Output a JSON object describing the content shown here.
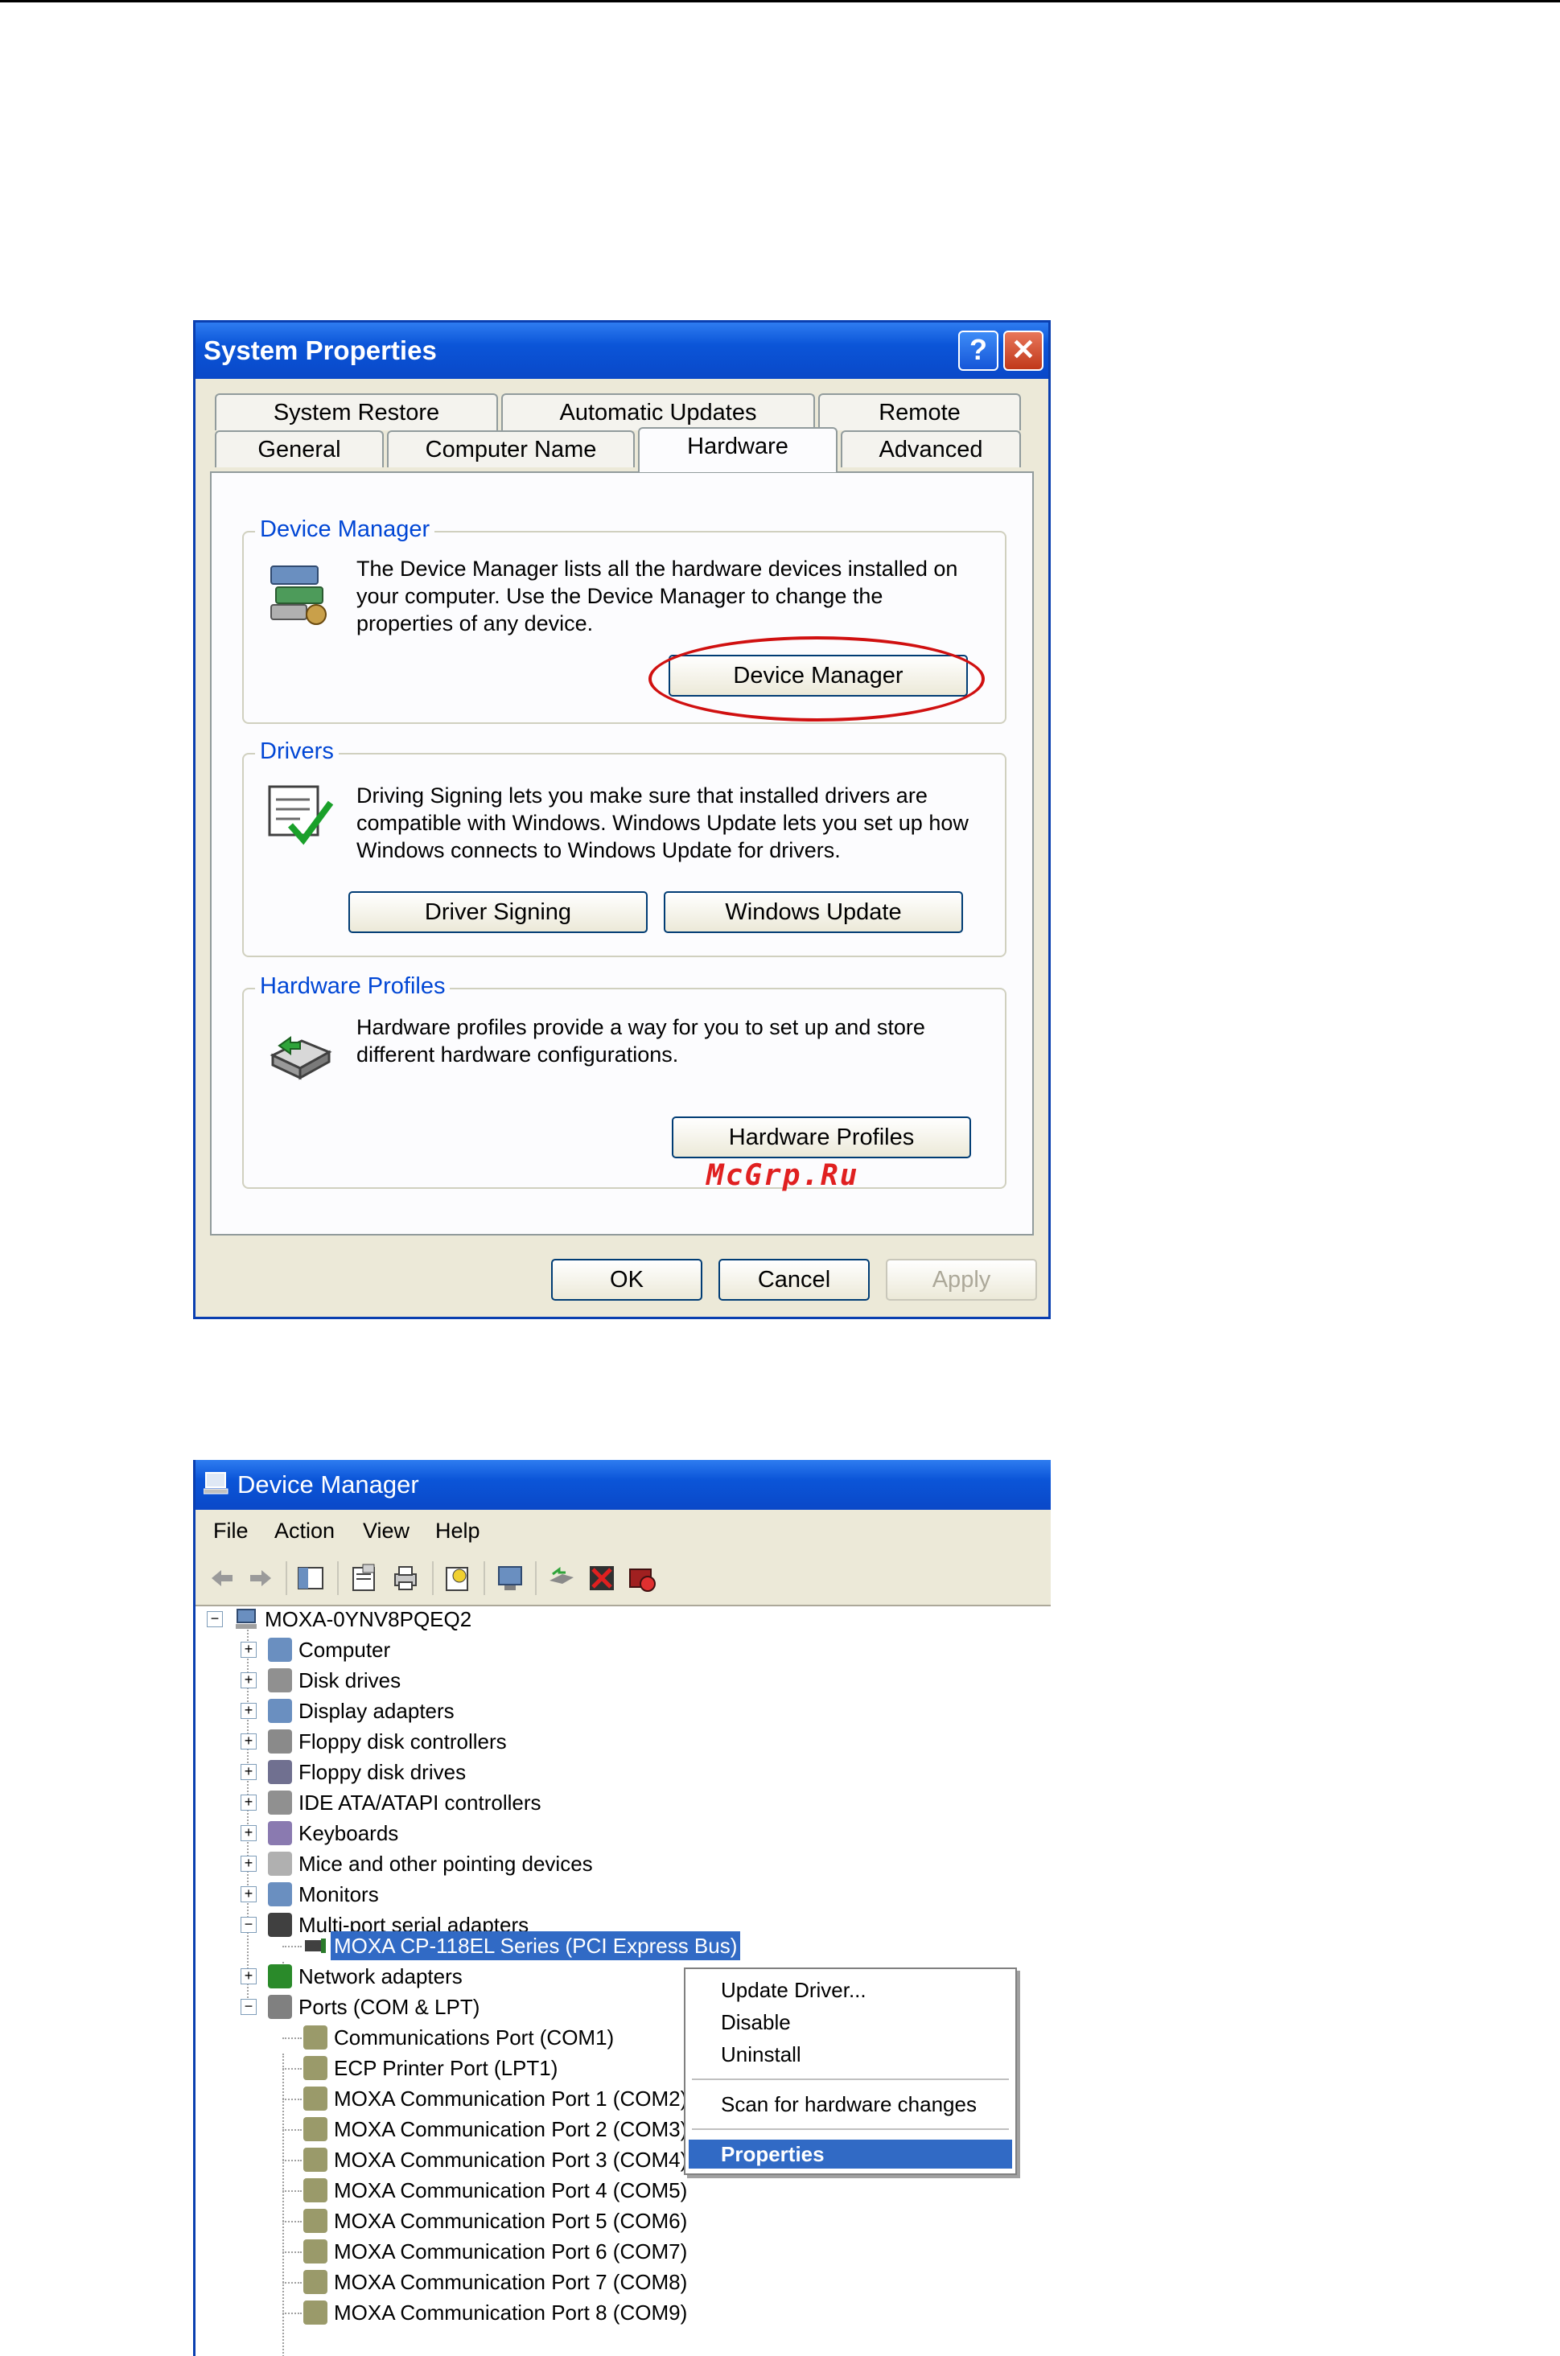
{
  "system_properties": {
    "title": "System Properties",
    "help_glyph": "?",
    "close_glyph": "✕",
    "tabs_row1": [
      "System Restore",
      "Automatic Updates",
      "Remote"
    ],
    "tabs_row2": [
      "General",
      "Computer Name",
      "Hardware",
      "Advanced"
    ],
    "active_tab": "Hardware",
    "groups": {
      "device_manager": {
        "title": "Device Manager",
        "text": "The Device Manager lists all the hardware devices installed on your computer. Use the Device Manager to change the properties of any device.",
        "button": "Device Manager",
        "icon": "device-manager-icon"
      },
      "drivers": {
        "title": "Drivers",
        "text": "Driving Signing lets you make sure that installed drivers are compatible with Windows. Windows Update lets you set up how Windows connects to Windows Update for drivers.",
        "button_signing": "Driver Signing",
        "button_update": "Windows Update",
        "icon": "driver-checklist-icon"
      },
      "hardware_profiles": {
        "title": "Hardware Profiles",
        "text": "Hardware profiles provide a way for you to set up and store different hardware configurations.",
        "button": "Hardware Profiles",
        "icon": "hardware-profiles-icon"
      }
    },
    "buttons": {
      "ok": "OK",
      "cancel": "Cancel",
      "apply": "Apply"
    },
    "watermark": "McGrp.Ru",
    "highlight_color": "#d01010"
  },
  "device_manager": {
    "title": "Device Manager",
    "menu": [
      "File",
      "Action",
      "View",
      "Help"
    ],
    "toolbar_icons": [
      "back-arrow-icon",
      "forward-arrow-icon",
      "show-hide-tree-icon",
      "properties-icon",
      "print-icon",
      "help-icon",
      "scan-hardware-icon",
      "update-driver-icon",
      "uninstall-icon",
      "disable-icon"
    ],
    "root": "MOXA-0YNV8PQEQ2",
    "categories": [
      "Computer",
      "Disk drives",
      "Display adapters",
      "Floppy disk controllers",
      "Floppy disk drives",
      "IDE ATA/ATAPI controllers",
      "Keyboards",
      "Mice and other pointing devices",
      "Monitors",
      "Multi-port serial adapters"
    ],
    "selected_device": "MOXA CP-118EL Series (PCI Express Bus)",
    "after_categories": [
      "Network adapters",
      "Ports (COM & LPT)"
    ],
    "ports": [
      "Communications Port (COM1)",
      "ECP Printer Port (LPT1)",
      "MOXA Communication Port 1 (COM2)",
      "MOXA Communication Port 2 (COM3)",
      "MOXA Communication Port 3 (COM4)",
      "MOXA Communication Port 4 (COM5)",
      "MOXA Communication Port 5 (COM6)",
      "MOXA Communication Port 6 (COM7)",
      "MOXA Communication Port 7 (COM8)",
      "MOXA Communication Port 8 (COM9)"
    ],
    "context_menu": {
      "items": [
        "Update Driver...",
        "Disable",
        "Uninstall"
      ],
      "scan": "Scan for hardware changes",
      "properties": "Properties"
    },
    "expander_plus": "+",
    "expander_minus": "−"
  }
}
